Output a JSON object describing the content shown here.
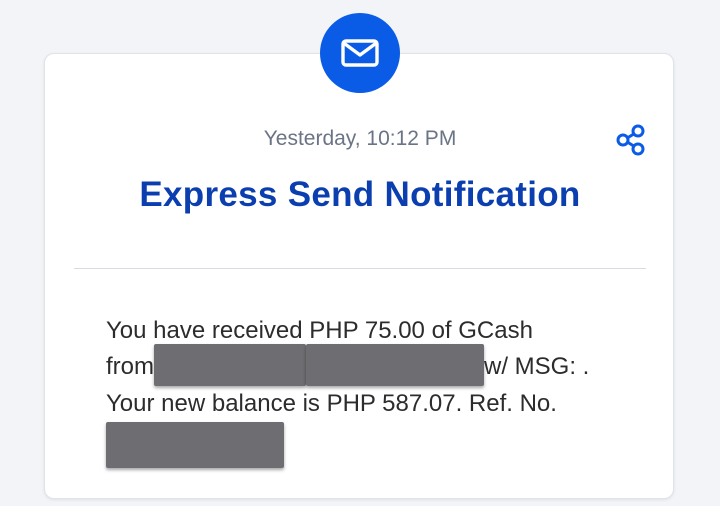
{
  "notification": {
    "timestamp": "Yesterday, 10:12 PM",
    "title": "Express Send Notification",
    "message": {
      "line1": "You have received PHP 75.00 of GCash",
      "line2_prefix": "from",
      "line2_suffix": "w/ MSG: .",
      "line3": "Your new balance is PHP 587.07. Ref. No."
    }
  },
  "icons": {
    "header": "envelope-icon",
    "share": "share-icon"
  },
  "colors": {
    "accent_blue": "#0a5ce6",
    "title_blue": "#0b3fb0",
    "timestamp_gray": "#6b7486",
    "redaction_gray": "#6e6e72"
  }
}
